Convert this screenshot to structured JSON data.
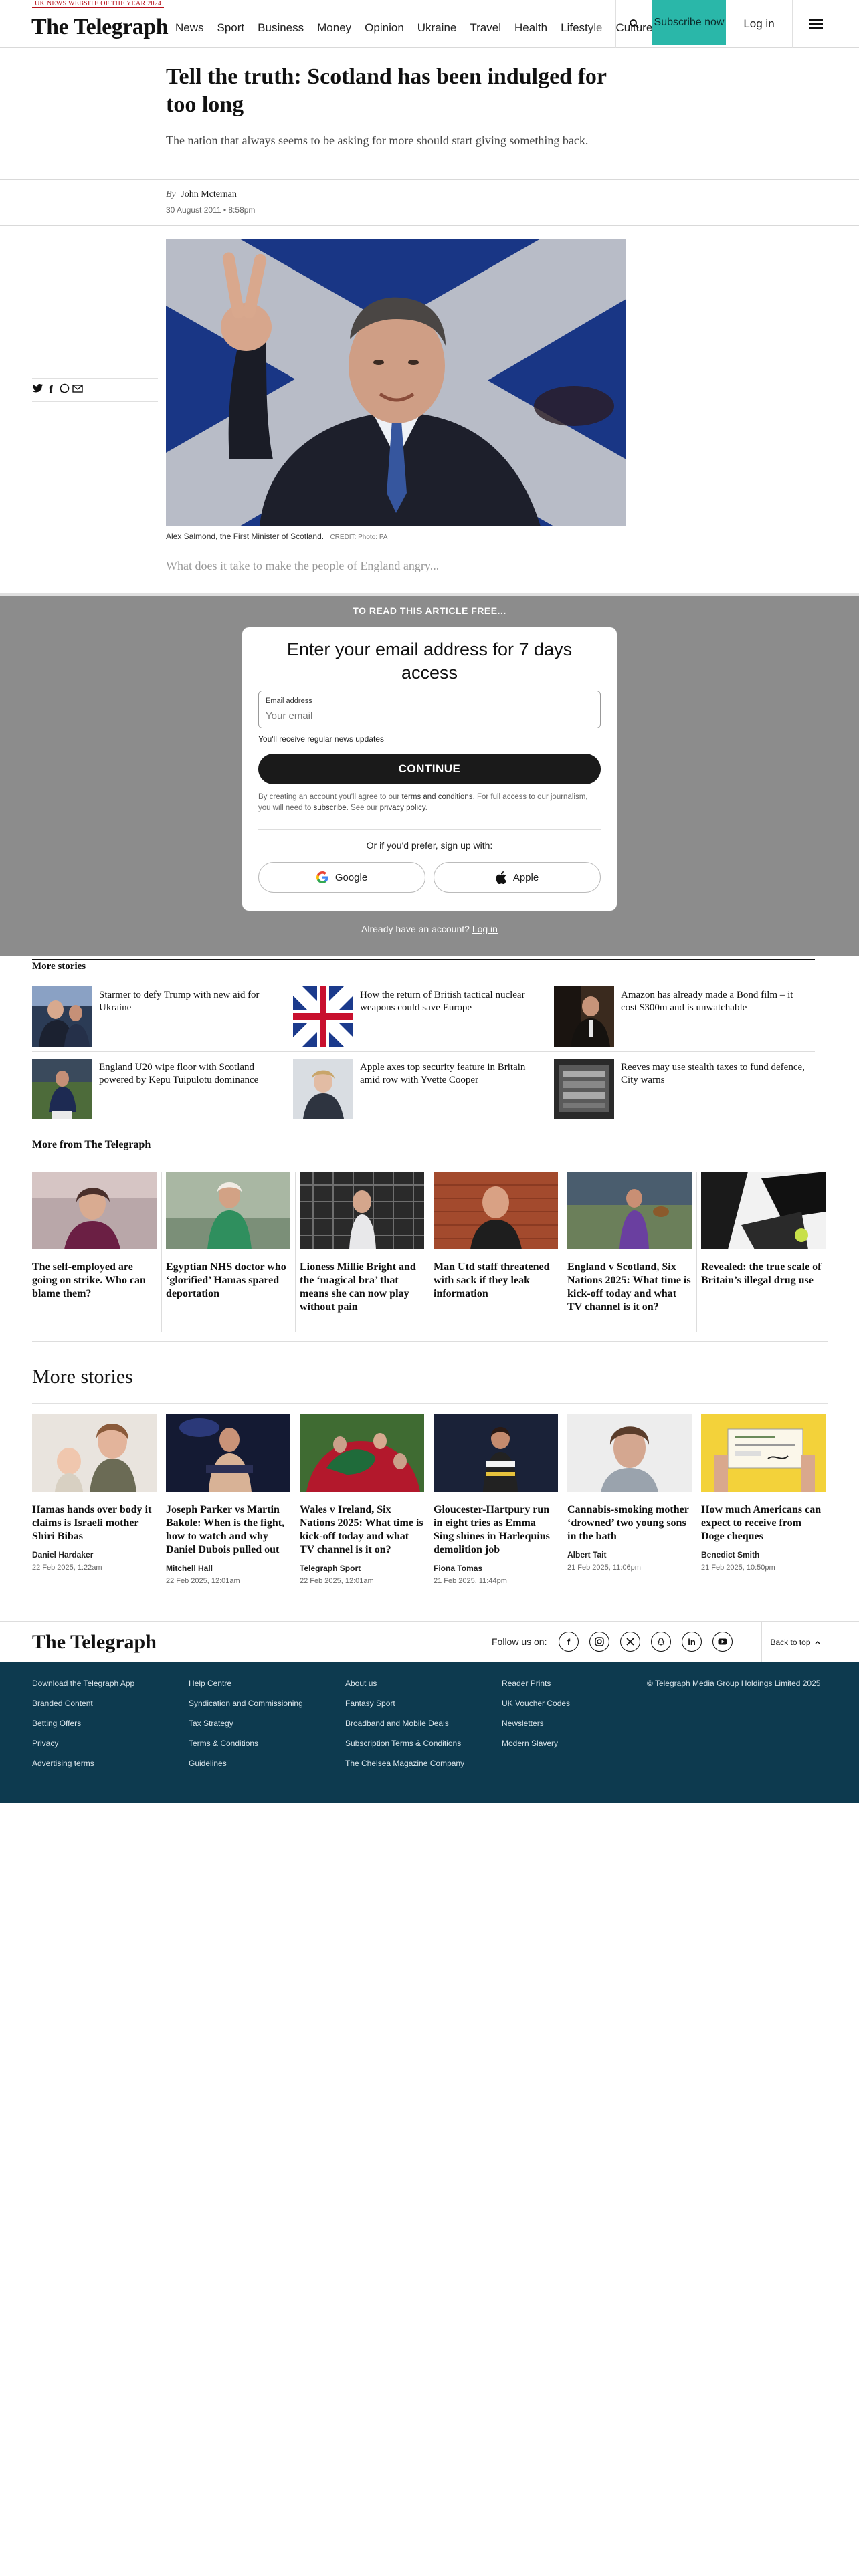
{
  "header": {
    "award": "UK NEWS WEBSITE OF THE YEAR 2024",
    "logo": "The Telegraph",
    "nav": [
      "News",
      "Sport",
      "Business",
      "Money",
      "Opinion",
      "Ukraine",
      "Travel",
      "Health",
      "Lifestyle",
      "Culture"
    ],
    "subscribe": "Subscribe now",
    "login": "Log in"
  },
  "article": {
    "headline": "Tell the truth: Scotland has been indulged for too long",
    "standfirst": "The nation that always seems to be asking for more should start giving something back.",
    "by": "By",
    "author": "John Mcternan",
    "date": "30 August 2011 • 8:58pm",
    "caption": "Alex Salmond, the First Minister of Scotland.",
    "credit": "CREDIT: Photo: PA",
    "teaser": "What does it take to make the people of England angry..."
  },
  "paywall": {
    "top": "TO READ THIS ARTICLE FREE...",
    "title": "Enter your email address for 7 days access",
    "email_label": "Email address",
    "email_placeholder": "Your email",
    "note": "You'll receive regular news updates",
    "continue": "CONTINUE",
    "legal_1": "By creating an account you'll agree to our ",
    "legal_terms": "terms and conditions",
    "legal_2": ". For full access to our journalism, you will need to ",
    "legal_subscribe": "subscribe",
    "legal_3": ". See our ",
    "legal_privacy": "privacy policy",
    "legal_4": ".",
    "or": "Or if you'd prefer, sign up with:",
    "google": "Google",
    "apple": "Apple",
    "have_account": "Already have an account?",
    "login_link": "Log in"
  },
  "more_stories_1": {
    "title": "More stories",
    "items": [
      "Starmer to defy Trump with new aid for Ukraine",
      "How the return of British tactical nuclear weapons could save Europe",
      "Amazon has already made a Bond film – it cost $300m and is unwatchable",
      "England U20 wipe floor with Scotland powered by Kepu Tuipulotu dominance",
      "Apple axes top security feature in Britain amid row with Yvette Cooper",
      "Reeves may use stealth taxes to fund defence, City warns"
    ]
  },
  "more_from": {
    "title": "More from The Telegraph",
    "cards": [
      {
        "headline": "The self-employed are going on strike. Who can blame them?"
      },
      {
        "headline": "Egyptian NHS doctor who ‘glorified’ Hamas spared deportation"
      },
      {
        "headline": "Lioness Millie Bright and the ‘magical bra’ that means she can now play without pain"
      },
      {
        "headline": "Man Utd staff threatened with sack if they leak information"
      },
      {
        "headline": "England v Scotland, Six Nations 2025: What time is kick-off today and what TV channel is it on?"
      },
      {
        "headline": "Revealed: the true scale of Britain’s illegal drug use"
      }
    ]
  },
  "more_stories_2": {
    "title": "More stories",
    "cards": [
      {
        "headline": "Hamas hands over body it claims is Israeli mother Shiri Bibas",
        "author": "Daniel Hardaker",
        "date": "22 Feb 2025, 1:22am"
      },
      {
        "headline": "Joseph Parker vs Martin Bakole: When is the fight, how to watch and why Daniel Dubois pulled out",
        "author": "Mitchell Hall",
        "date": "22 Feb 2025, 12:01am"
      },
      {
        "headline": "Wales v Ireland, Six Nations 2025: What time is kick-off today and what TV channel is it on?",
        "author": "Telegraph Sport",
        "date": "22 Feb 2025, 12:01am"
      },
      {
        "headline": "Gloucester-Hartpury run in eight tries as Emma Sing shines in Harlequins demolition job",
        "author": "Fiona Tomas",
        "date": "21 Feb 2025, 11:44pm"
      },
      {
        "headline": "Cannabis-smoking mother ‘drowned’ two young sons in the bath",
        "author": "Albert Tait",
        "date": "21 Feb 2025, 11:06pm"
      },
      {
        "headline": "How much Americans can expect to receive from Doge cheques",
        "author": "Benedict Smith",
        "date": "21 Feb 2025, 10:50pm"
      }
    ]
  },
  "footer": {
    "logo": "The Telegraph",
    "follow": "Follow us on:",
    "back_to_top": "Back to top",
    "col1": [
      "Download the Telegraph App",
      "Branded Content",
      "Betting Offers",
      "Privacy",
      "Advertising terms"
    ],
    "col2": [
      "Help Centre",
      "Syndication and Commissioning",
      "Tax Strategy",
      "Terms & Conditions",
      "Guidelines"
    ],
    "col3": [
      "About us",
      "Fantasy Sport",
      "Broadband and Mobile Deals",
      "Subscription Terms & Conditions",
      "The Chelsea Magazine Company"
    ],
    "col4": [
      "Reader Prints",
      "UK Voucher Codes",
      "Newsletters",
      "Modern Slavery"
    ],
    "copyright": "© Telegraph Media Group Holdings Limited 2025"
  },
  "colors": {
    "accent": "#2ab7a9",
    "footer_bg": "#0d3a4f",
    "paywall_bg": "#8c8c8c"
  }
}
